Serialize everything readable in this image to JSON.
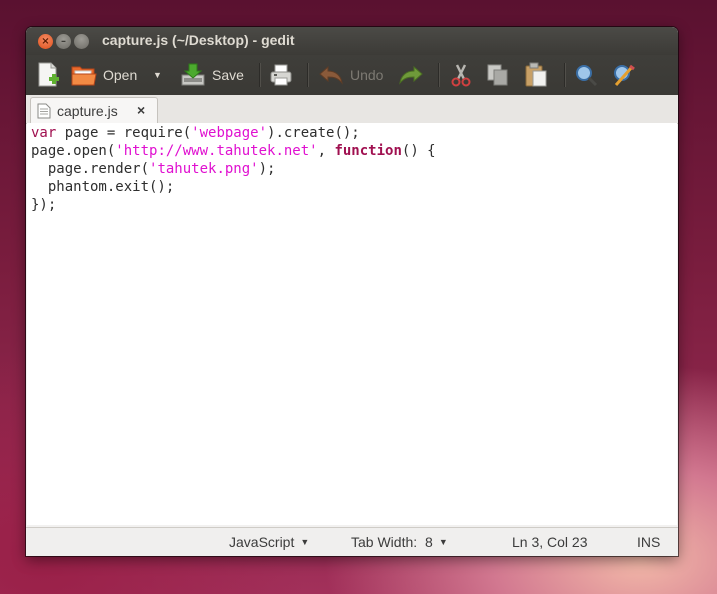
{
  "window": {
    "title": "capture.js (~/Desktop) - gedit"
  },
  "toolbar": {
    "new_icon": "new-document-icon",
    "open_label": "Open",
    "open_menu_icon": "dropdown-arrow-icon",
    "save_label": "Save",
    "print_icon": "print-icon",
    "undo_label": "Undo",
    "redo_icon": "redo-icon",
    "cut_icon": "cut-icon",
    "copy_icon": "copy-icon",
    "paste_icon": "paste-icon",
    "find_icon": "search-icon",
    "replace_icon": "replace-icon"
  },
  "tabs": [
    {
      "label": "capture.js",
      "close": "×"
    }
  ],
  "editor": {
    "lines": [
      [
        {
          "t": "var",
          "c": "kw-plain"
        },
        {
          "t": " page = require(",
          "c": ""
        },
        {
          "t": "'webpage'",
          "c": "str"
        },
        {
          "t": ").create();",
          "c": ""
        }
      ],
      [
        {
          "t": "page.open(",
          "c": ""
        },
        {
          "t": "'http://www.tahutek.net'",
          "c": "str"
        },
        {
          "t": ", ",
          "c": ""
        },
        {
          "t": "function",
          "c": "kw"
        },
        {
          "t": "() {",
          "c": ""
        }
      ],
      [
        {
          "t": "  page.render(",
          "c": ""
        },
        {
          "t": "'tahutek.png'",
          "c": "str"
        },
        {
          "t": ");",
          "c": ""
        }
      ],
      [
        {
          "t": "  phantom.exit();",
          "c": ""
        }
      ],
      [
        {
          "t": "});",
          "c": ""
        }
      ]
    ]
  },
  "statusbar": {
    "language": "JavaScript",
    "tab_width_label": "Tab Width:",
    "tab_width_value": "8",
    "position": "Ln 3, Col 23",
    "mode": "INS"
  },
  "colors": {
    "keyword": "#a01050",
    "string": "#e010d0",
    "titlebar": "#3c3b37"
  }
}
